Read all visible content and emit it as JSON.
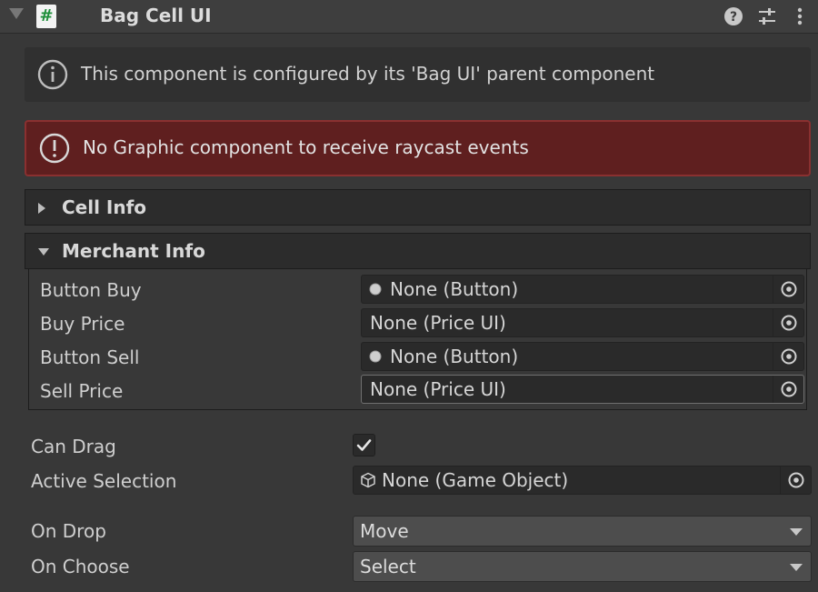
{
  "header": {
    "title": "Bag Cell UI",
    "script_icon_glyph": "#",
    "icons": [
      "help-icon",
      "preset-icon",
      "more-options-icon"
    ]
  },
  "info_box": {
    "text": "This component is configured by its 'Bag UI' parent component",
    "icon": "info-icon"
  },
  "error_box": {
    "text": "No Graphic component to receive raycast events",
    "icon": "error-icon",
    "color": "#5f1f1f"
  },
  "cell_info": {
    "label": "Cell Info",
    "expanded": false
  },
  "merchant_info": {
    "label": "Merchant Info",
    "expanded": true,
    "fields": [
      {
        "label": "Button Buy",
        "value": "None (Button)",
        "icon": "button-icon"
      },
      {
        "label": "Buy Price",
        "value": "None (Price UI)",
        "icon": ""
      },
      {
        "label": "Button Sell",
        "value": "None (Button)",
        "icon": "button-icon"
      },
      {
        "label": "Sell Price",
        "value": "None (Price UI)",
        "icon": ""
      }
    ]
  },
  "can_drag": {
    "label": "Can Drag",
    "checked": true
  },
  "active_selection": {
    "label": "Active Selection",
    "value": "None (Game Object)",
    "icon": "cube-icon"
  },
  "on_drop": {
    "label": "On Drop",
    "value": "Move"
  },
  "on_choose": {
    "label": "On Choose",
    "value": "Select"
  }
}
